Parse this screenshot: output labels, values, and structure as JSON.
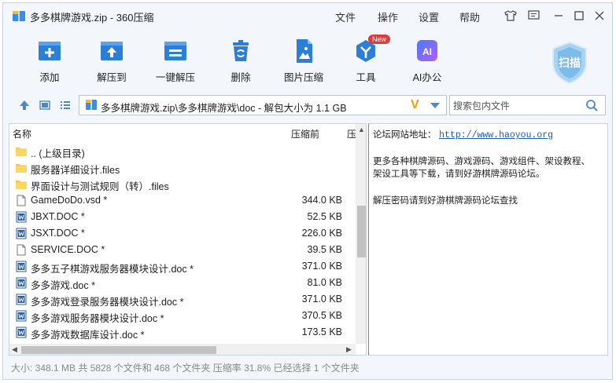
{
  "window": {
    "title": "多多棋牌游戏.zip - 360压缩"
  },
  "menu": [
    "文件",
    "操作",
    "设置",
    "帮助"
  ],
  "toolbar": {
    "add": "添加",
    "extract_to": "解压到",
    "one_click_extract": "一键解压",
    "delete": "删除",
    "image_compress": "图片压缩",
    "tools": "工具",
    "tools_badge": "New",
    "ai_office": "AI办公",
    "ai_icon_text": "AI",
    "scan": "扫描"
  },
  "address": {
    "path": "多多棋牌游戏.zip\\多多棋牌游戏\\doc - 解包大小为 1.1 GB",
    "v_mark": "V"
  },
  "search": {
    "placeholder": "搜索包内文件"
  },
  "columns": {
    "name": "名称",
    "compressed": "压缩前",
    "ratio": "压"
  },
  "files": [
    {
      "name": ".. (上级目录)",
      "size": "",
      "type": "folder"
    },
    {
      "name": "服务器详细设计.files",
      "size": "",
      "type": "folder"
    },
    {
      "name": "界面设计与测试规则（转）.files",
      "size": "",
      "type": "folder"
    },
    {
      "name": "GameDoDo.vsd *",
      "size": "344.0 KB",
      "type": "file"
    },
    {
      "name": "JBXT.DOC *",
      "size": "52.5 KB",
      "type": "doc"
    },
    {
      "name": "JSXT.DOC *",
      "size": "226.0 KB",
      "type": "doc"
    },
    {
      "name": "SERVICE.DOC *",
      "size": "39.5 KB",
      "type": "file"
    },
    {
      "name": "多多五子棋游戏服务器模块设计.doc *",
      "size": "371.0 KB",
      "type": "doc"
    },
    {
      "name": "多多游戏.doc *",
      "size": "81.0 KB",
      "type": "doc"
    },
    {
      "name": "多多游戏登录服务器模块设计.doc *",
      "size": "371.0 KB",
      "type": "doc"
    },
    {
      "name": "多多游戏服务器模块设计.doc *",
      "size": "370.5 KB",
      "type": "doc"
    },
    {
      "name": "多多游戏数据库设计.doc *",
      "size": "173.5 KB",
      "type": "doc"
    }
  ],
  "info": {
    "forum_label": "论坛网站地址：",
    "forum_url": "http://www.haoyou.org",
    "line2": "更多各种棋牌源码、游戏源码、游戏组件、架设教程、",
    "line3": "架设工具等下载，请到好游棋牌源码论坛。",
    "line4": "解压密码请到好游棋牌源码论坛查找"
  },
  "status": "大小: 348.1 MB 共 5828 个文件和 468 个文件夹 压缩率 31.8% 已经选择 1 个文件夹",
  "colors": {
    "accent": "#2b7fd4",
    "folder": "#f7c948"
  }
}
